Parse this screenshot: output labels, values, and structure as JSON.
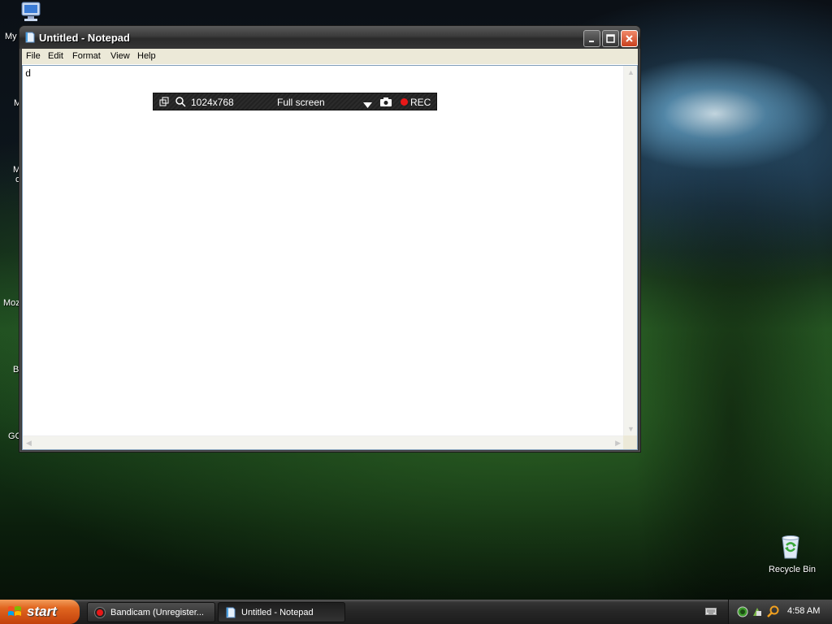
{
  "desktop": {
    "labels": [
      "My",
      "M",
      "M",
      "c",
      "Moz",
      "B",
      "GC"
    ],
    "recycle_bin": "Recycle Bin"
  },
  "notepad": {
    "title": "Untitled - Notepad",
    "menu": [
      "File",
      "Edit",
      "Format",
      "View",
      "Help"
    ],
    "content": "d"
  },
  "bandicam_bar": {
    "resolution": "1024x768",
    "mode": "Full screen",
    "rec_label": "REC"
  },
  "taskbar": {
    "start_label": "start",
    "tasks": [
      {
        "label": "Bandicam (Unregister...",
        "icon": "bandicam-icon",
        "active": false
      },
      {
        "label": "Untitled - Notepad",
        "icon": "notepad-icon",
        "active": true
      }
    ],
    "clock": "4:58 AM"
  },
  "colors": {
    "rec": "#e81818",
    "start": "#e0651f"
  }
}
